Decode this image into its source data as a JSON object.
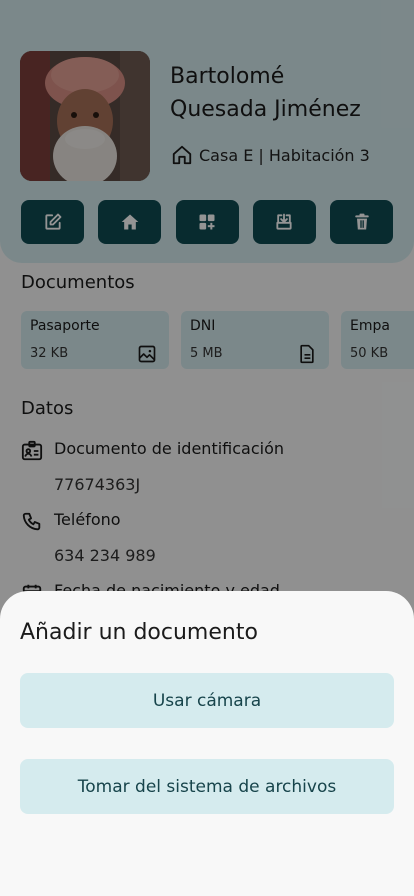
{
  "profile": {
    "name_line1": "Bartolomé",
    "name_line2": "Quesada Jiménez",
    "location": "Casa E | Habitación 3"
  },
  "actions": [
    {
      "icon": "edit-icon"
    },
    {
      "icon": "home-icon"
    },
    {
      "icon": "add-widget-icon"
    },
    {
      "icon": "download-icon"
    },
    {
      "icon": "trash-icon"
    }
  ],
  "documents": {
    "title": "Documentos",
    "items": [
      {
        "name": "Pasaporte",
        "size": "32 KB",
        "icon": "image-icon"
      },
      {
        "name": "DNI",
        "size": "5 MB",
        "icon": "file-icon"
      },
      {
        "name": "Empa",
        "size": "50 KB",
        "icon": "file-icon"
      }
    ]
  },
  "datos": {
    "title": "Datos",
    "fields": [
      {
        "label": "Documento de identificación",
        "value": "77674363J",
        "icon": "id-card-icon"
      },
      {
        "label": "Teléfono",
        "value": "634 234 989",
        "icon": "phone-icon"
      },
      {
        "label": "Fecha de nacimiento y edad",
        "value": "",
        "icon": "calendar-icon"
      }
    ]
  },
  "sheet": {
    "title": "Añadir un documento",
    "camera_label": "Usar cámara",
    "files_label": "Tomar del sistema de archivos"
  },
  "colors": {
    "accent_dark": "#0e4a52",
    "accent_light": "#d5ebee",
    "overlay": "rgba(0,0,0,0.42)"
  }
}
